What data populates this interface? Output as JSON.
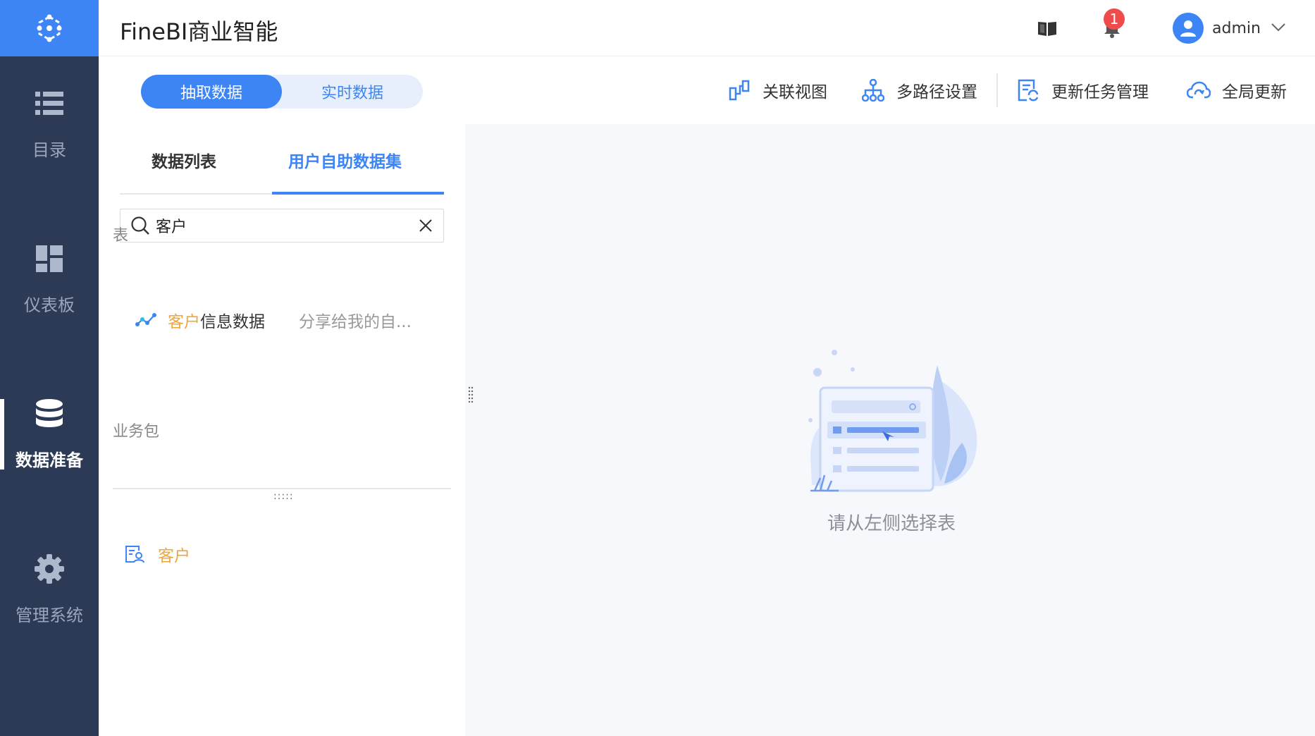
{
  "app": {
    "title": "FineBI商业智能"
  },
  "header": {
    "notification_count": "1",
    "user_name": "admin"
  },
  "sidebar": {
    "items": [
      {
        "label": "目录",
        "icon": "list-icon",
        "active": false
      },
      {
        "label": "仪表板",
        "icon": "dashboard-icon",
        "active": false
      },
      {
        "label": "数据准备",
        "icon": "database-icon",
        "active": true
      },
      {
        "label": "管理系统",
        "icon": "gear-icon",
        "active": false
      }
    ]
  },
  "mode_switch": {
    "options": [
      "抽取数据",
      "实时数据"
    ],
    "selected": "抽取数据"
  },
  "toolbar": {
    "items": [
      {
        "label": "关联视图",
        "icon": "relation-view-icon"
      },
      {
        "label": "多路径设置",
        "icon": "multipath-icon"
      },
      {
        "label": "更新任务管理",
        "icon": "task-update-icon"
      },
      {
        "label": "全局更新",
        "icon": "cloud-refresh-icon"
      }
    ]
  },
  "left_panel": {
    "tabs": [
      {
        "label": "数据列表",
        "active": false
      },
      {
        "label": "用户自助数据集",
        "active": true
      }
    ],
    "search": {
      "value": "客户",
      "placeholder": ""
    },
    "table_section_label": "表",
    "tables": [
      {
        "match": "客户",
        "rest": "信息数据",
        "share": "分享给我的自..."
      }
    ],
    "package_section_label": "业务包",
    "packages": [
      {
        "name": "客户"
      }
    ]
  },
  "main": {
    "empty_text": "请从左侧选择表"
  },
  "colors": {
    "accent": "#3d85f5",
    "sidebar_bg": "#2c3a55",
    "highlight": "#f0a63b",
    "badge": "#ef4b4b"
  }
}
